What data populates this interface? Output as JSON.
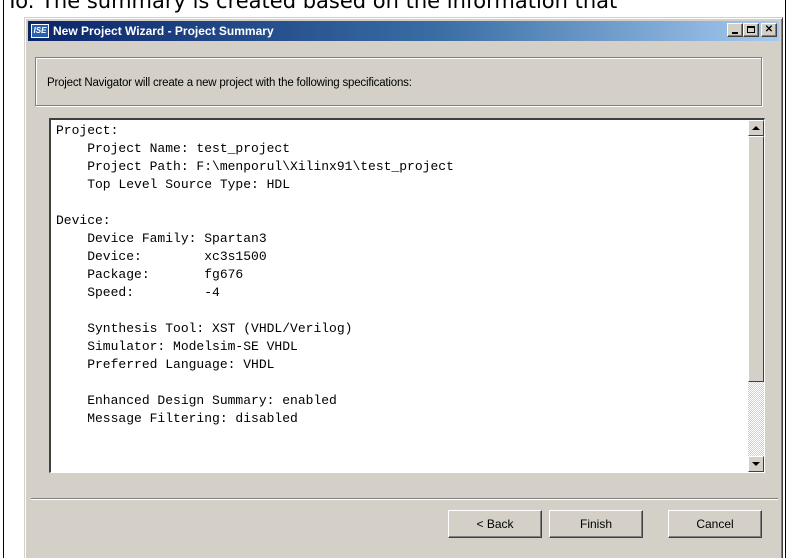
{
  "page_background_text": "To. The summary is created based on the information that",
  "window": {
    "title": "New Project Wizard - Project Summary",
    "icon_name": "ise-app-icon",
    "icon_text": "ISE",
    "close_glyph": "✕"
  },
  "header": {
    "description": "Project Navigator will create a new project with the following specifications:"
  },
  "summary": {
    "lines": [
      "Project:",
      "    Project Name: test_project",
      "    Project Path: F:\\menporul\\Xilinx91\\test_project",
      "    Top Level Source Type: HDL",
      "",
      "Device:",
      "    Device Family: Spartan3",
      "    Device:        xc3s1500",
      "    Package:       fg676",
      "    Speed:         -4",
      "",
      "    Synthesis Tool: XST (VHDL/Verilog)",
      "    Simulator: Modelsim-SE VHDL",
      "    Preferred Language: VHDL",
      "",
      "    Enhanced Design Summary: enabled",
      "    Message Filtering: disabled"
    ]
  },
  "buttons": {
    "back": "< Back",
    "finish": "Finish",
    "cancel": "Cancel"
  },
  "colors": {
    "titlebar_start": "#0a246a",
    "titlebar_end": "#a6caf0",
    "dialog_face": "#d4d0c8"
  }
}
